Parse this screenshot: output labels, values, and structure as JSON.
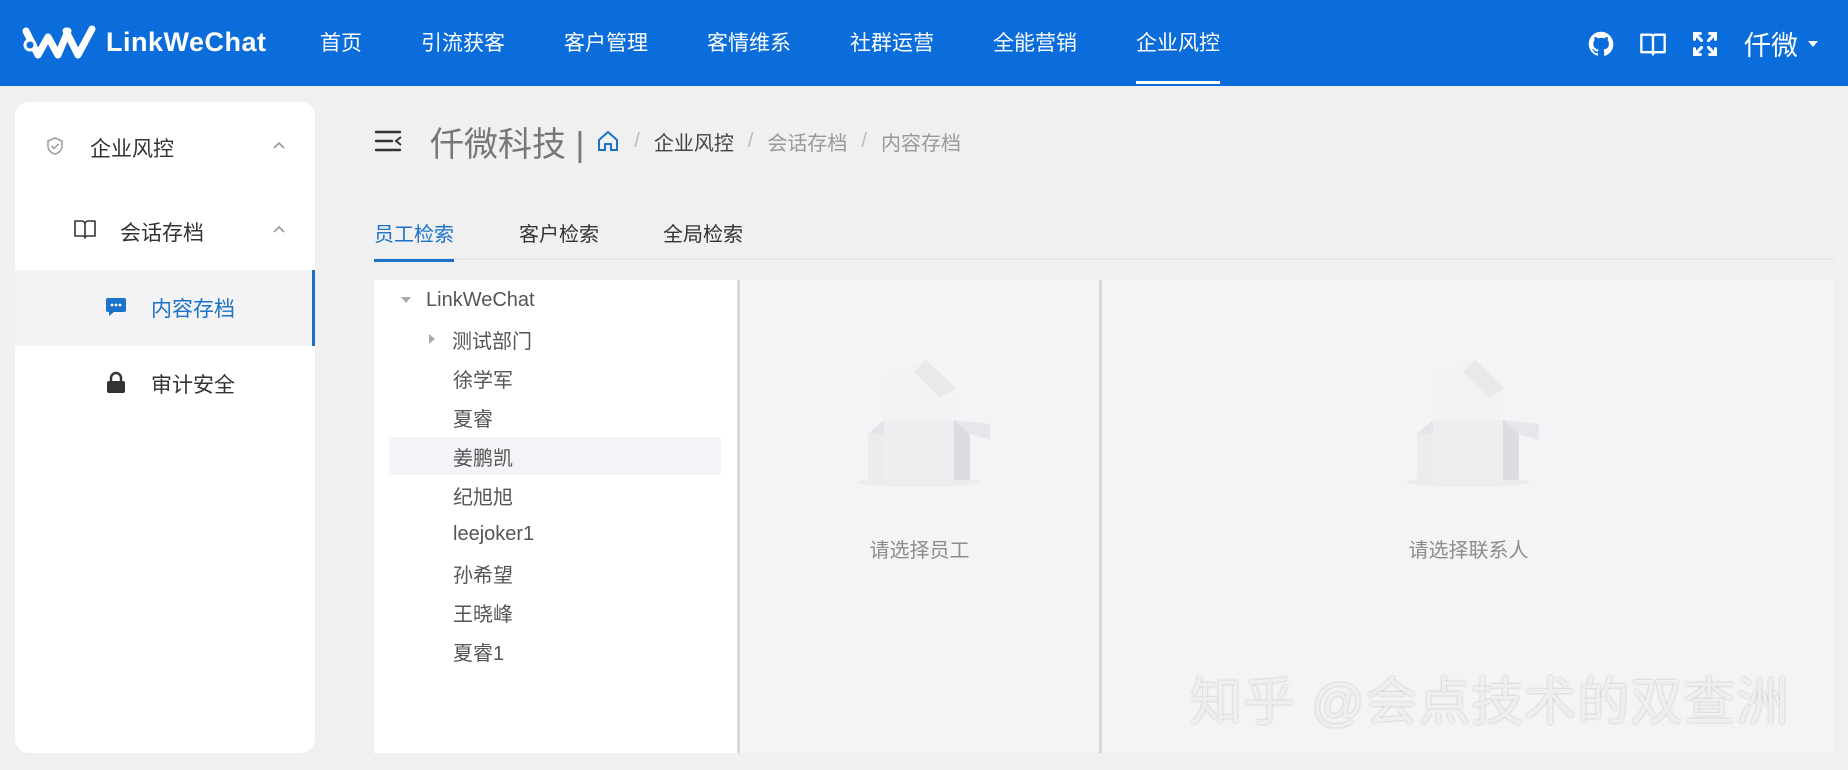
{
  "app": {
    "logo_text": "LinkWeChat"
  },
  "nav": {
    "items": [
      {
        "label": "首页"
      },
      {
        "label": "引流获客"
      },
      {
        "label": "客户管理"
      },
      {
        "label": "客情维系"
      },
      {
        "label": "社群运营"
      },
      {
        "label": "全能营销"
      },
      {
        "label": "企业风控"
      }
    ],
    "active_index": 6
  },
  "user": {
    "name": "仟微"
  },
  "sidebar": {
    "group": {
      "label": "企业风控",
      "icon": "shield-icon"
    },
    "subgroup": {
      "label": "会话存档",
      "icon": "book-icon"
    },
    "items": [
      {
        "label": "内容存档",
        "icon": "chat-icon",
        "active": true
      },
      {
        "label": "审计安全",
        "icon": "lock-icon",
        "active": false
      }
    ]
  },
  "header": {
    "company": "仟微科技 |",
    "breadcrumb": [
      "企业风控",
      "会话存档",
      "内容存档"
    ]
  },
  "tabs": [
    {
      "label": "员工检索",
      "active": true
    },
    {
      "label": "客户检索",
      "active": false
    },
    {
      "label": "全局检索",
      "active": false
    }
  ],
  "tree": {
    "root": "LinkWeChat",
    "department": "测试部门",
    "members": [
      "徐学军",
      "夏睿",
      "姜鹏凯",
      "纪旭旭",
      "leejoker1",
      "孙希望",
      "王晓峰",
      "夏睿1"
    ],
    "highlighted": "姜鹏凯"
  },
  "panels": {
    "employee_empty": "请选择员工",
    "contact_empty": "请选择联系人"
  },
  "watermark": "知乎 @会点技术的双查洲",
  "colors": {
    "primary": "#0a6ddb",
    "accent": "#1a73c8"
  }
}
